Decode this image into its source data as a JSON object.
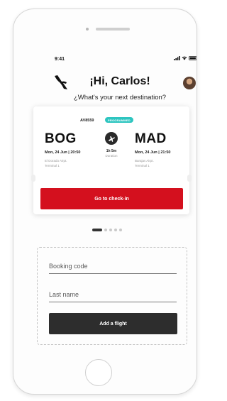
{
  "status": {
    "time": "9:41"
  },
  "header": {
    "greeting": "¡Hi, Carlos!",
    "subtitle": "¿What's your next destination?"
  },
  "flight_card": {
    "flight_number": "AV8559",
    "status_badge": "PROGRAMMED",
    "badge_color": "#2ec5c0",
    "origin": {
      "code": "BOG",
      "date_time": "Mon, 24 Jun | 20:50",
      "airport": "El Dorado Airpt.",
      "terminal": "Terminal 1"
    },
    "destination": {
      "code": "MAD",
      "date_time": "Mon, 24 Jun | 21:50",
      "airport": "Barajas Airpt.",
      "terminal": "Terminal 1"
    },
    "duration": "1h 5m",
    "duration_label": "Duration",
    "checkin_label": "Go to check-in",
    "checkin_color": "#d4101e"
  },
  "carousel": {
    "total": 5,
    "active_index": 0
  },
  "add_flight": {
    "booking_placeholder": "Booking code",
    "lastname_placeholder": "Last name",
    "button_label": "Add a flight"
  }
}
